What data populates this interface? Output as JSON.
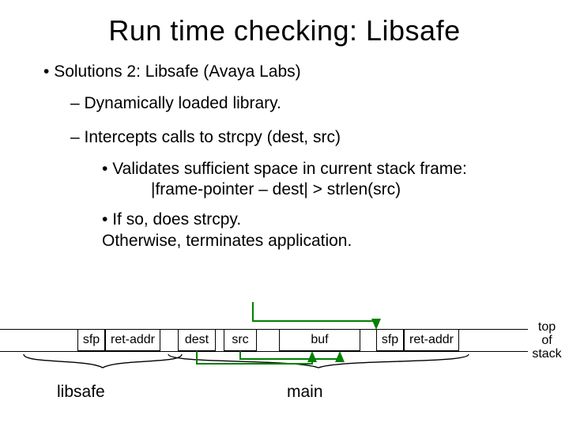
{
  "title": "Run time checking: Libsafe",
  "b1": "Solutions 2:  Libsafe (Avaya Labs)",
  "b2a": "Dynamically loaded library.",
  "b2b": "Intercepts calls to  strcpy (dest, src)",
  "b3a": "Validates sufficient space in current stack frame:",
  "b3a_cont": "|frame-pointer – dest| > strlen(src)",
  "b3b": "If so, does strcpy.",
  "b3b_cont": "Otherwise, terminates application.",
  "cells": {
    "sfp1": "sfp",
    "ret1": "ret-addr",
    "dest": "dest",
    "src": "src",
    "buf": "buf",
    "sfp2": "sfp",
    "ret2": "ret-addr"
  },
  "top_of_stack_l1": "top",
  "top_of_stack_l2": "of",
  "top_of_stack_l3": "stack",
  "label_libsafe": "libsafe",
  "label_main": "main"
}
